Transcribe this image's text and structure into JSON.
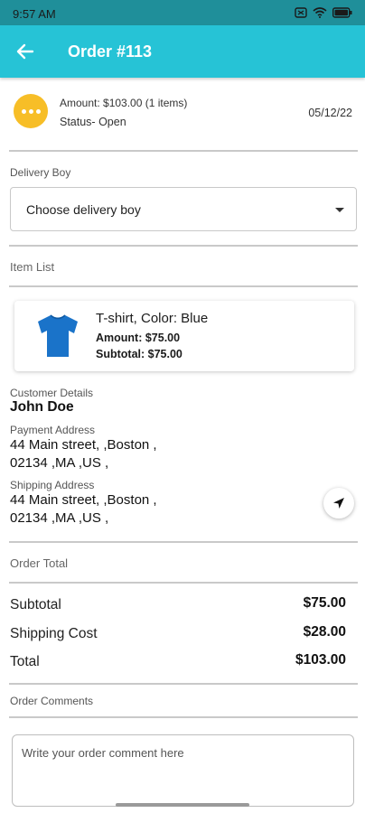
{
  "status_bar": {
    "time": "9:57 AM"
  },
  "app_bar": {
    "title": "Order #113"
  },
  "summary": {
    "amount": "Amount: $103.00 (1 items)",
    "status": "Status- Open",
    "date": "05/12/22",
    "status_color": "#f7be27"
  },
  "delivery": {
    "label": "Delivery Boy",
    "placeholder": "Choose delivery boy"
  },
  "item_list": {
    "label": "Item List",
    "items": [
      {
        "name": "T-shirt, Color: Blue",
        "amount": "Amount: $75.00",
        "subtotal": "Subtotal: $75.00"
      }
    ]
  },
  "customer": {
    "label": "Customer Details",
    "name": "John Doe",
    "payment_label": "Payment Address",
    "payment_line1": "44 Main street, ,Boston ,",
    "payment_line2": "02134 ,MA ,US ,",
    "shipping_label": "Shipping Address",
    "shipping_line1": "44 Main street, ,Boston ,",
    "shipping_line2": "02134 ,MA ,US ,"
  },
  "totals": {
    "label": "Order Total",
    "subtotal_label": "Subtotal",
    "subtotal_value": "$75.00",
    "shipping_label": "Shipping Cost",
    "shipping_value": "$28.00",
    "total_label": "Total",
    "total_value": "$103.00"
  },
  "comments": {
    "label": "Order Comments",
    "placeholder": "Write your order comment here"
  },
  "colors": {
    "accent": "#26c3d6",
    "status_bar": "#1f8f9a",
    "shirt": "#1a73c9"
  }
}
